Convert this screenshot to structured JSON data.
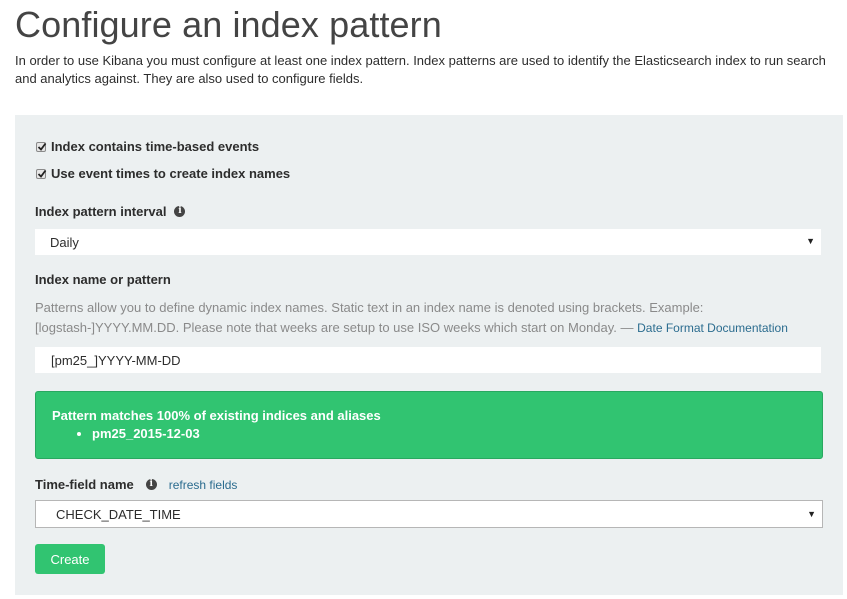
{
  "page": {
    "title": "Configure an index pattern",
    "intro": "In order to use Kibana you must configure at least one index pattern. Index patterns are used to identify the Elasticsearch index to run search and analytics against. They are also used to configure fields."
  },
  "form": {
    "time_based_label": "Index contains time-based events",
    "time_based_checked": true,
    "event_times_label": "Use event times to create index names",
    "event_times_checked": true,
    "interval_label": "Index pattern interval",
    "interval_value": "Daily",
    "name_label": "Index name or pattern",
    "name_help": "Patterns allow you to define dynamic index names. Static text in an index name is denoted using brackets. Example: [logstash-]YYYY.MM.DD. Please note that weeks are setup to use ISO weeks which start on Monday. — ",
    "name_help_link": "Date Format Documentation",
    "name_value": "[pm25_]YYYY-MM-DD",
    "match_message": "Pattern matches 100% of existing indices and aliases",
    "matched_indices": [
      "pm25_2015-12-03"
    ],
    "time_field_label": "Time-field name",
    "refresh_fields_label": "refresh fields",
    "time_field_value": "CHECK_DATE_TIME",
    "create_label": "Create"
  },
  "icons": {
    "info": "info-icon",
    "select_arrow": "caret-down-icon",
    "check": "checkmark-icon"
  },
  "colors": {
    "success": "#31c471",
    "link": "#2b6c8f",
    "panel_bg": "#ecf0f1"
  }
}
